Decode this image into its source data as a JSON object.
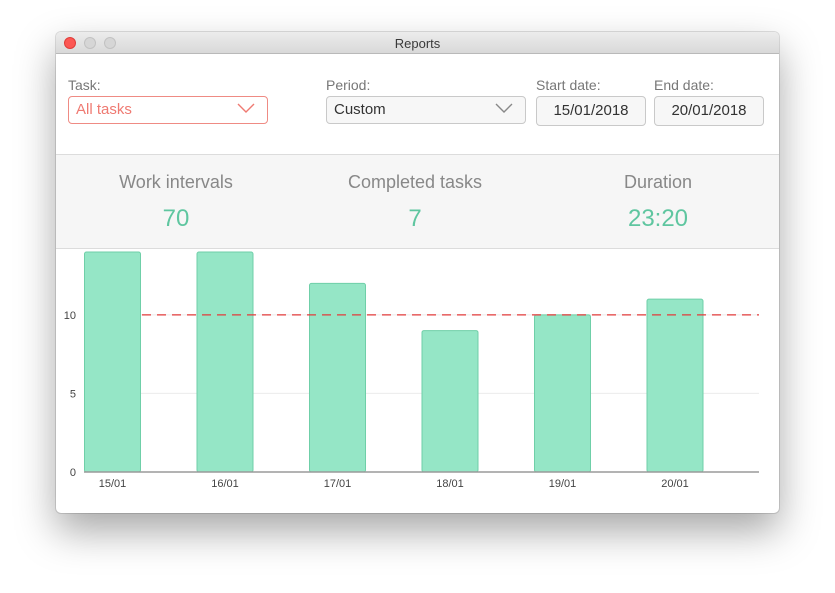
{
  "window": {
    "title": "Reports"
  },
  "filters": {
    "task_label": "Task:",
    "task_value": "All tasks",
    "period_label": "Period:",
    "period_value": "Custom",
    "start_label": "Start date:",
    "start_value": "15/01/2018",
    "end_label": "End date:",
    "end_value": "20/01/2018"
  },
  "stats": {
    "work_intervals_label": "Work intervals",
    "work_intervals_value": "70",
    "completed_tasks_label": "Completed tasks",
    "completed_tasks_value": "7",
    "duration_label": "Duration",
    "duration_value": "23:20"
  },
  "colors": {
    "accent": "#5fc6a0",
    "bar_fill": "#95e6c6",
    "bar_stroke": "#6fcfa8",
    "goal_line": "#e23b3b",
    "task_select": "#ef7a72"
  },
  "chart_data": {
    "type": "bar",
    "categories": [
      "15/01",
      "16/01",
      "17/01",
      "18/01",
      "19/01",
      "20/01"
    ],
    "values": [
      14,
      14,
      12,
      9,
      10,
      11
    ],
    "yticks": [
      0,
      5,
      10
    ],
    "ylim": [
      0,
      14
    ],
    "reference_line": 10,
    "grid": true
  }
}
